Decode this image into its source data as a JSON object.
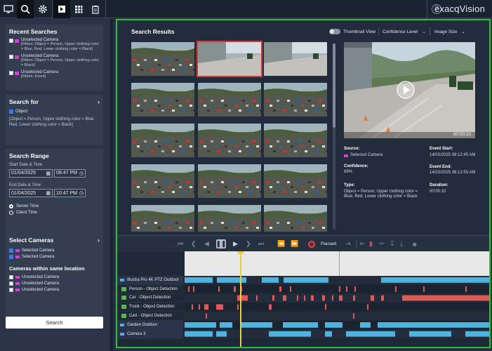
{
  "app": {
    "brand": "exacqVision",
    "help": "?"
  },
  "toolbar": {
    "icons": [
      "monitor-icon",
      "search-icon",
      "gear-icon",
      "export-icon",
      "grid-icon",
      "clipboard-icon"
    ]
  },
  "sidebar": {
    "recent_title": "Recent Searches",
    "recent": [
      {
        "title": "Unselected Camera",
        "filters": "[Filters: Object = Person, Upper clothing color = Blue, Red, Lower clothing color = Black]"
      },
      {
        "title": "Unselected Camera",
        "filters": "[Filters: Object = Person, Upper clothing color = Black]"
      },
      {
        "title": "Unselected Camera",
        "filters": "[Filters: Event]"
      }
    ],
    "search_for_title": "Search for",
    "object_label": "Object",
    "object_desc": "[Object = Person, Upper clothing color = Blue, Red, Lower clothing color = Black]",
    "range_title": "Search Range",
    "start_label": "Start Date & Time",
    "start_date": "01/04/2025",
    "start_time": "08:47 PM",
    "end_label": "End Date & Time",
    "end_date": "01/04/2025",
    "end_time": "10:47 PM",
    "server_time": "Server Time",
    "client_time": "Client Time",
    "select_cams_title": "Select Cameras",
    "selected": [
      "Selected Camera",
      "Selected Camera"
    ],
    "same_loc_title": "Cameras within same location",
    "unselected": [
      "Unselected Camera",
      "Unselected Camera",
      "Unselected Camera"
    ],
    "search_button": "Search"
  },
  "results": {
    "title": "Search Results",
    "thumbnail_view": "Thumbnail View",
    "confidence": "Confidence Level",
    "image_size": "Image Size",
    "duration_overlay": "00:00:10",
    "source_label": "Source:",
    "source_value": "Selected Camera",
    "confidence_label": "Confidence:",
    "confidence_value": "89%",
    "type_label": "Type:",
    "type_value": "Object = Person; Upper clothing color = Blue, Red; Lower clothing color = Black",
    "event_start_label": "Event Start:",
    "event_start_value": "14/03/2025 08:12:45 AM",
    "event_end_label": "Event End:",
    "event_end_value": "14/03/2025 08:12:55 AM",
    "duration_label": "Duration:",
    "duration_value": "00:00:10"
  },
  "playback": {
    "status": "Paused"
  },
  "timeline": {
    "tracks": [
      {
        "label": "Illustra Pro 4K PTZ Outdoor",
        "kind": "camera"
      },
      {
        "label": "Person - Object Detection",
        "kind": "detection"
      },
      {
        "label": "Car - Object Detection",
        "kind": "detection"
      },
      {
        "label": "Truck - Object Detection",
        "kind": "detection"
      },
      {
        "label": "Cart - Object Detection",
        "kind": "detection"
      },
      {
        "label": "Garden Outdoor",
        "kind": "camera"
      },
      {
        "label": "Camera 3",
        "kind": "camera"
      }
    ]
  },
  "colors": {
    "accent": "#28c23a",
    "camera": "#d43fd9",
    "detection": "#e25a55",
    "video": "#4fb3dd"
  }
}
